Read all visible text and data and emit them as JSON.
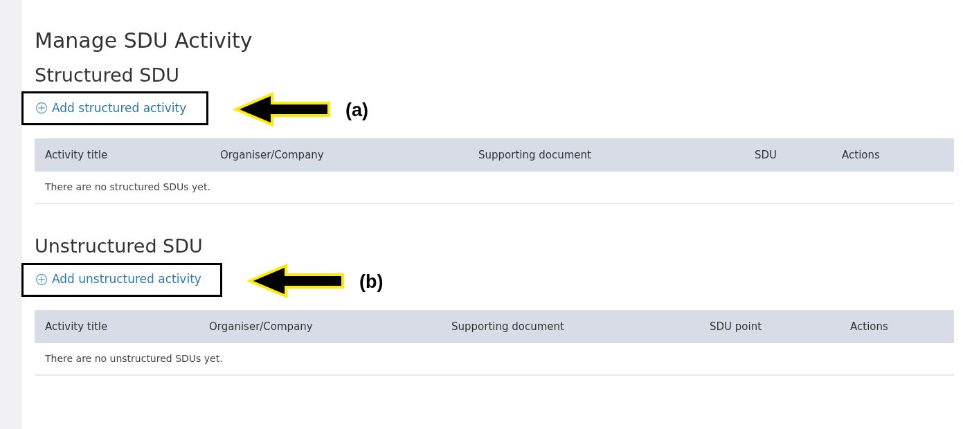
{
  "page_title": "Manage SDU Activity",
  "sections": [
    {
      "heading": "Structured SDU",
      "add_link": "Add structured activity",
      "annotation": "(a)",
      "columns": [
        "Activity title",
        "Organiser/Company",
        "Supporting document",
        "SDU",
        "Actions"
      ],
      "empty_message": "There are no structured SDUs yet."
    },
    {
      "heading": "Unstructured SDU",
      "add_link": "Add unstructured activity",
      "annotation": "(b)",
      "columns": [
        "Activity title",
        "Organiser/Company",
        "Supporting document",
        "SDU point",
        "Actions"
      ],
      "empty_message": "There are no unstructured SDUs yet."
    }
  ]
}
